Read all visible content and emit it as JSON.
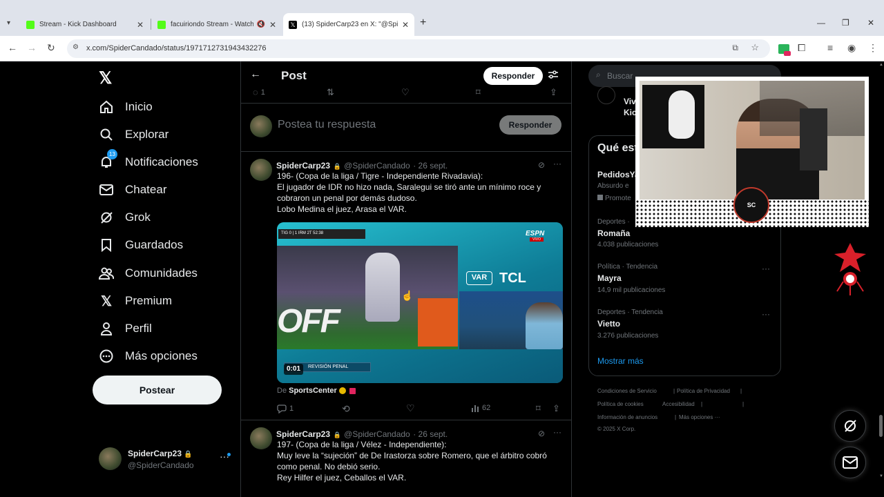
{
  "browser": {
    "tabs": [
      {
        "title": "Stream - Kick Dashboard"
      },
      {
        "title": "facuiriondo Stream - Watch"
      },
      {
        "title": "(13) SpiderCarp23 en X: \"@Spid"
      }
    ],
    "url": "x.com/SpiderCandado/status/1971712731943432276"
  },
  "nav": {
    "items": [
      {
        "label": "Inicio",
        "icon": "home-icon"
      },
      {
        "label": "Explorar",
        "icon": "search-icon"
      },
      {
        "label": "Notificaciones",
        "icon": "bell-icon",
        "badge": "13"
      },
      {
        "label": "Chatear",
        "icon": "mail-icon"
      },
      {
        "label": "Grok",
        "icon": "grok-icon"
      },
      {
        "label": "Guardados",
        "icon": "bookmark-icon"
      },
      {
        "label": "Comunidades",
        "icon": "people-icon"
      },
      {
        "label": "Premium",
        "icon": "x-logo-icon"
      },
      {
        "label": "Perfil",
        "icon": "person-icon"
      },
      {
        "label": "Más opciones",
        "icon": "more-circle-icon"
      }
    ],
    "post_button": "Postear",
    "account": {
      "name": "SpiderCarp23",
      "handle": "@SpiderCandado"
    }
  },
  "header": {
    "title": "Post",
    "reply_button": "Responder"
  },
  "top_actions": {
    "replies": "1"
  },
  "composer": {
    "placeholder": "Postea tu respuesta",
    "button": "Responder"
  },
  "tweets": [
    {
      "name": "SpiderCarp23",
      "handle": "@SpiderCandado",
      "date": "· 26 sept.",
      "lines": [
        "196- (Copa de la liga / Tigre - Independiente Rivadavia):",
        "El jugador de IDR no hizo nada, Saralegui se tiró ante un mínimo roce y",
        "cobraron un penal por demás dudoso.",
        "Lobo Medina el juez, Arasa el VAR."
      ],
      "media": {
        "scorebug": "TIG 0 | 1 IRM  2T 52:38",
        "brand": "ESPN",
        "brand_sub": "VIVO",
        "var_label": "VAR",
        "sponsor": "TCL",
        "off_text": "OFF",
        "banner": "REVISIÓN PENAL",
        "time": "0:01"
      },
      "source_prefix": "De",
      "source": "SportsCenter",
      "replies": "1",
      "views": "62"
    },
    {
      "name": "SpiderCarp23",
      "handle": "@SpiderCandado",
      "date": "· 26 sept.",
      "lines": [
        "197- (Copa de la liga / Vélez - Independiente):",
        "Muy leve la “sujeción” de De Irastorza sobre Romero, que el árbitro cobró",
        "como penal. No debió serio.",
        "Rey Hilfer el juez, Ceballos el VAR."
      ]
    }
  ],
  "right": {
    "search_placeholder": "Buscar",
    "partial_text": [
      "Viv",
      "Kic"
    ],
    "trends_title": "Qué est",
    "trends": [
      {
        "category": "",
        "name": "PedidosYa",
        "count": "Absurdo e",
        "promoted": "Promote"
      },
      {
        "category": "Deportes ·",
        "name": "Romaña",
        "count": "4.038 publicaciones"
      },
      {
        "category": "Política · Tendencia",
        "name": "Mayra",
        "count": "14,9 mil publicaciones"
      },
      {
        "category": "Deportes · Tendencia",
        "name": "Vietto",
        "count": "3.276 publicaciones"
      }
    ],
    "show_more": "Mostrar más",
    "footer": [
      [
        "Condiciones de Servicio",
        "|",
        "Política de Privacidad",
        "|"
      ],
      [
        "Política de cookies",
        "|",
        "Accesibilidad",
        "|"
      ],
      [
        "Información de anuncios",
        "|",
        "Más opciones ···"
      ],
      [
        "© 2025 X Corp."
      ]
    ]
  },
  "colors": {
    "accent": "#1d9bf0",
    "kick": "#53fc18",
    "bg": "#000000"
  }
}
